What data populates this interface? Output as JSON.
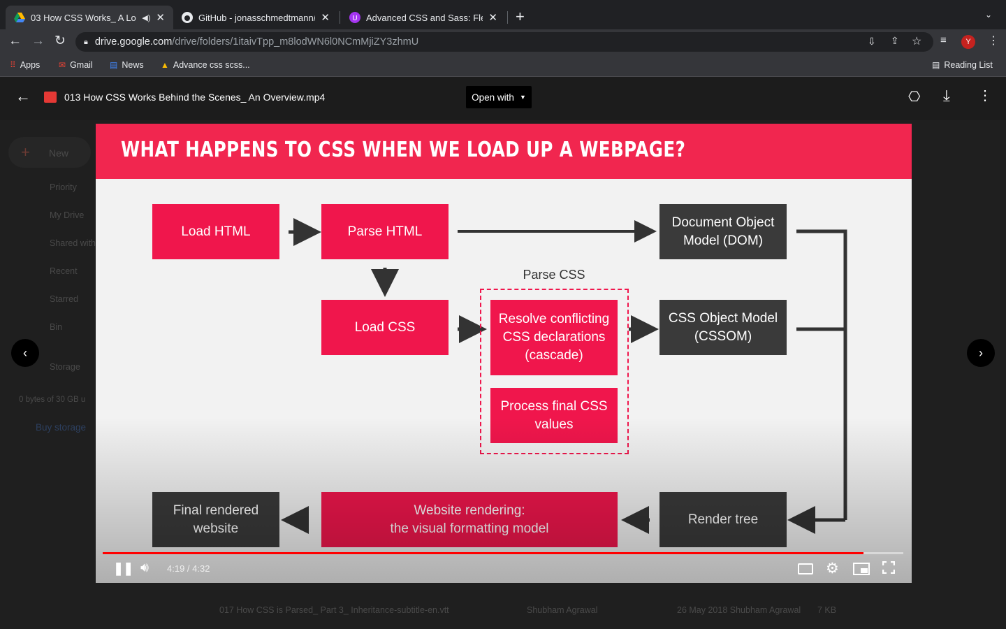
{
  "browser": {
    "tabs": [
      {
        "title": "03 How CSS Works_ A Lo",
        "favicon": "google-drive-icon",
        "muted_indicator": true
      },
      {
        "title": "GitHub - jonasschmedtmann/a",
        "favicon": "github-icon"
      },
      {
        "title": "Advanced CSS and Sass: Flexb",
        "favicon": "udemy-icon"
      }
    ],
    "new_tab": "+",
    "url_host": "drive.google.com",
    "url_path": "/drive/folders/1itaivTpp_m8lodWN6l0NCmMjiZY3zhmU",
    "profile_initial": "Y",
    "bookmarks": [
      "Apps",
      "Gmail",
      "News",
      "Advance css scss..."
    ],
    "reading_list": "Reading List"
  },
  "viewer": {
    "filename": "013 How CSS Works Behind the Scenes_ An Overview.mp4",
    "open_with": "Open with",
    "current_time": "4:19",
    "duration": "4:32",
    "time_display": "4:19 / 4:32",
    "progress_fraction": 0.95
  },
  "slide": {
    "title": "WHAT HAPPENS TO CSS WHEN WE LOAD UP A WEBPAGE?",
    "parse_css_label": "Parse CSS",
    "boxes": {
      "load_html": "Load HTML",
      "parse_html": "Parse HTML",
      "dom": "Document Object Model (DOM)",
      "load_css": "Load CSS",
      "resolve": "Resolve conflicting CSS declarations (cascade)",
      "process": "Process final CSS values",
      "cssom": "CSS Object Model (CSSOM)",
      "final": "Final rendered website",
      "rendering_line1": "Website rendering:",
      "rendering_line2": "the visual formatting model",
      "render_tree": "Render tree"
    }
  },
  "drive_background": {
    "new": "New",
    "nav": [
      "Priority",
      "My Drive",
      "Shared with",
      "Recent",
      "Starred",
      "Bin",
      "Storage"
    ],
    "storage_text": "0 bytes of 30 GB u",
    "buy_storage": "Buy storage",
    "file_row": {
      "name": "017 How CSS is Parsed_ Part 3_ Inheritance-subtitle-en.vtt",
      "owner": "Shubham Agrawal",
      "modified": "26 May 2018 Shubham Agrawal",
      "size": "7 KB"
    }
  },
  "colors": {
    "accent_red": "#f0164c",
    "dark_box": "#3a3a3a",
    "progress": "#ff0000"
  }
}
